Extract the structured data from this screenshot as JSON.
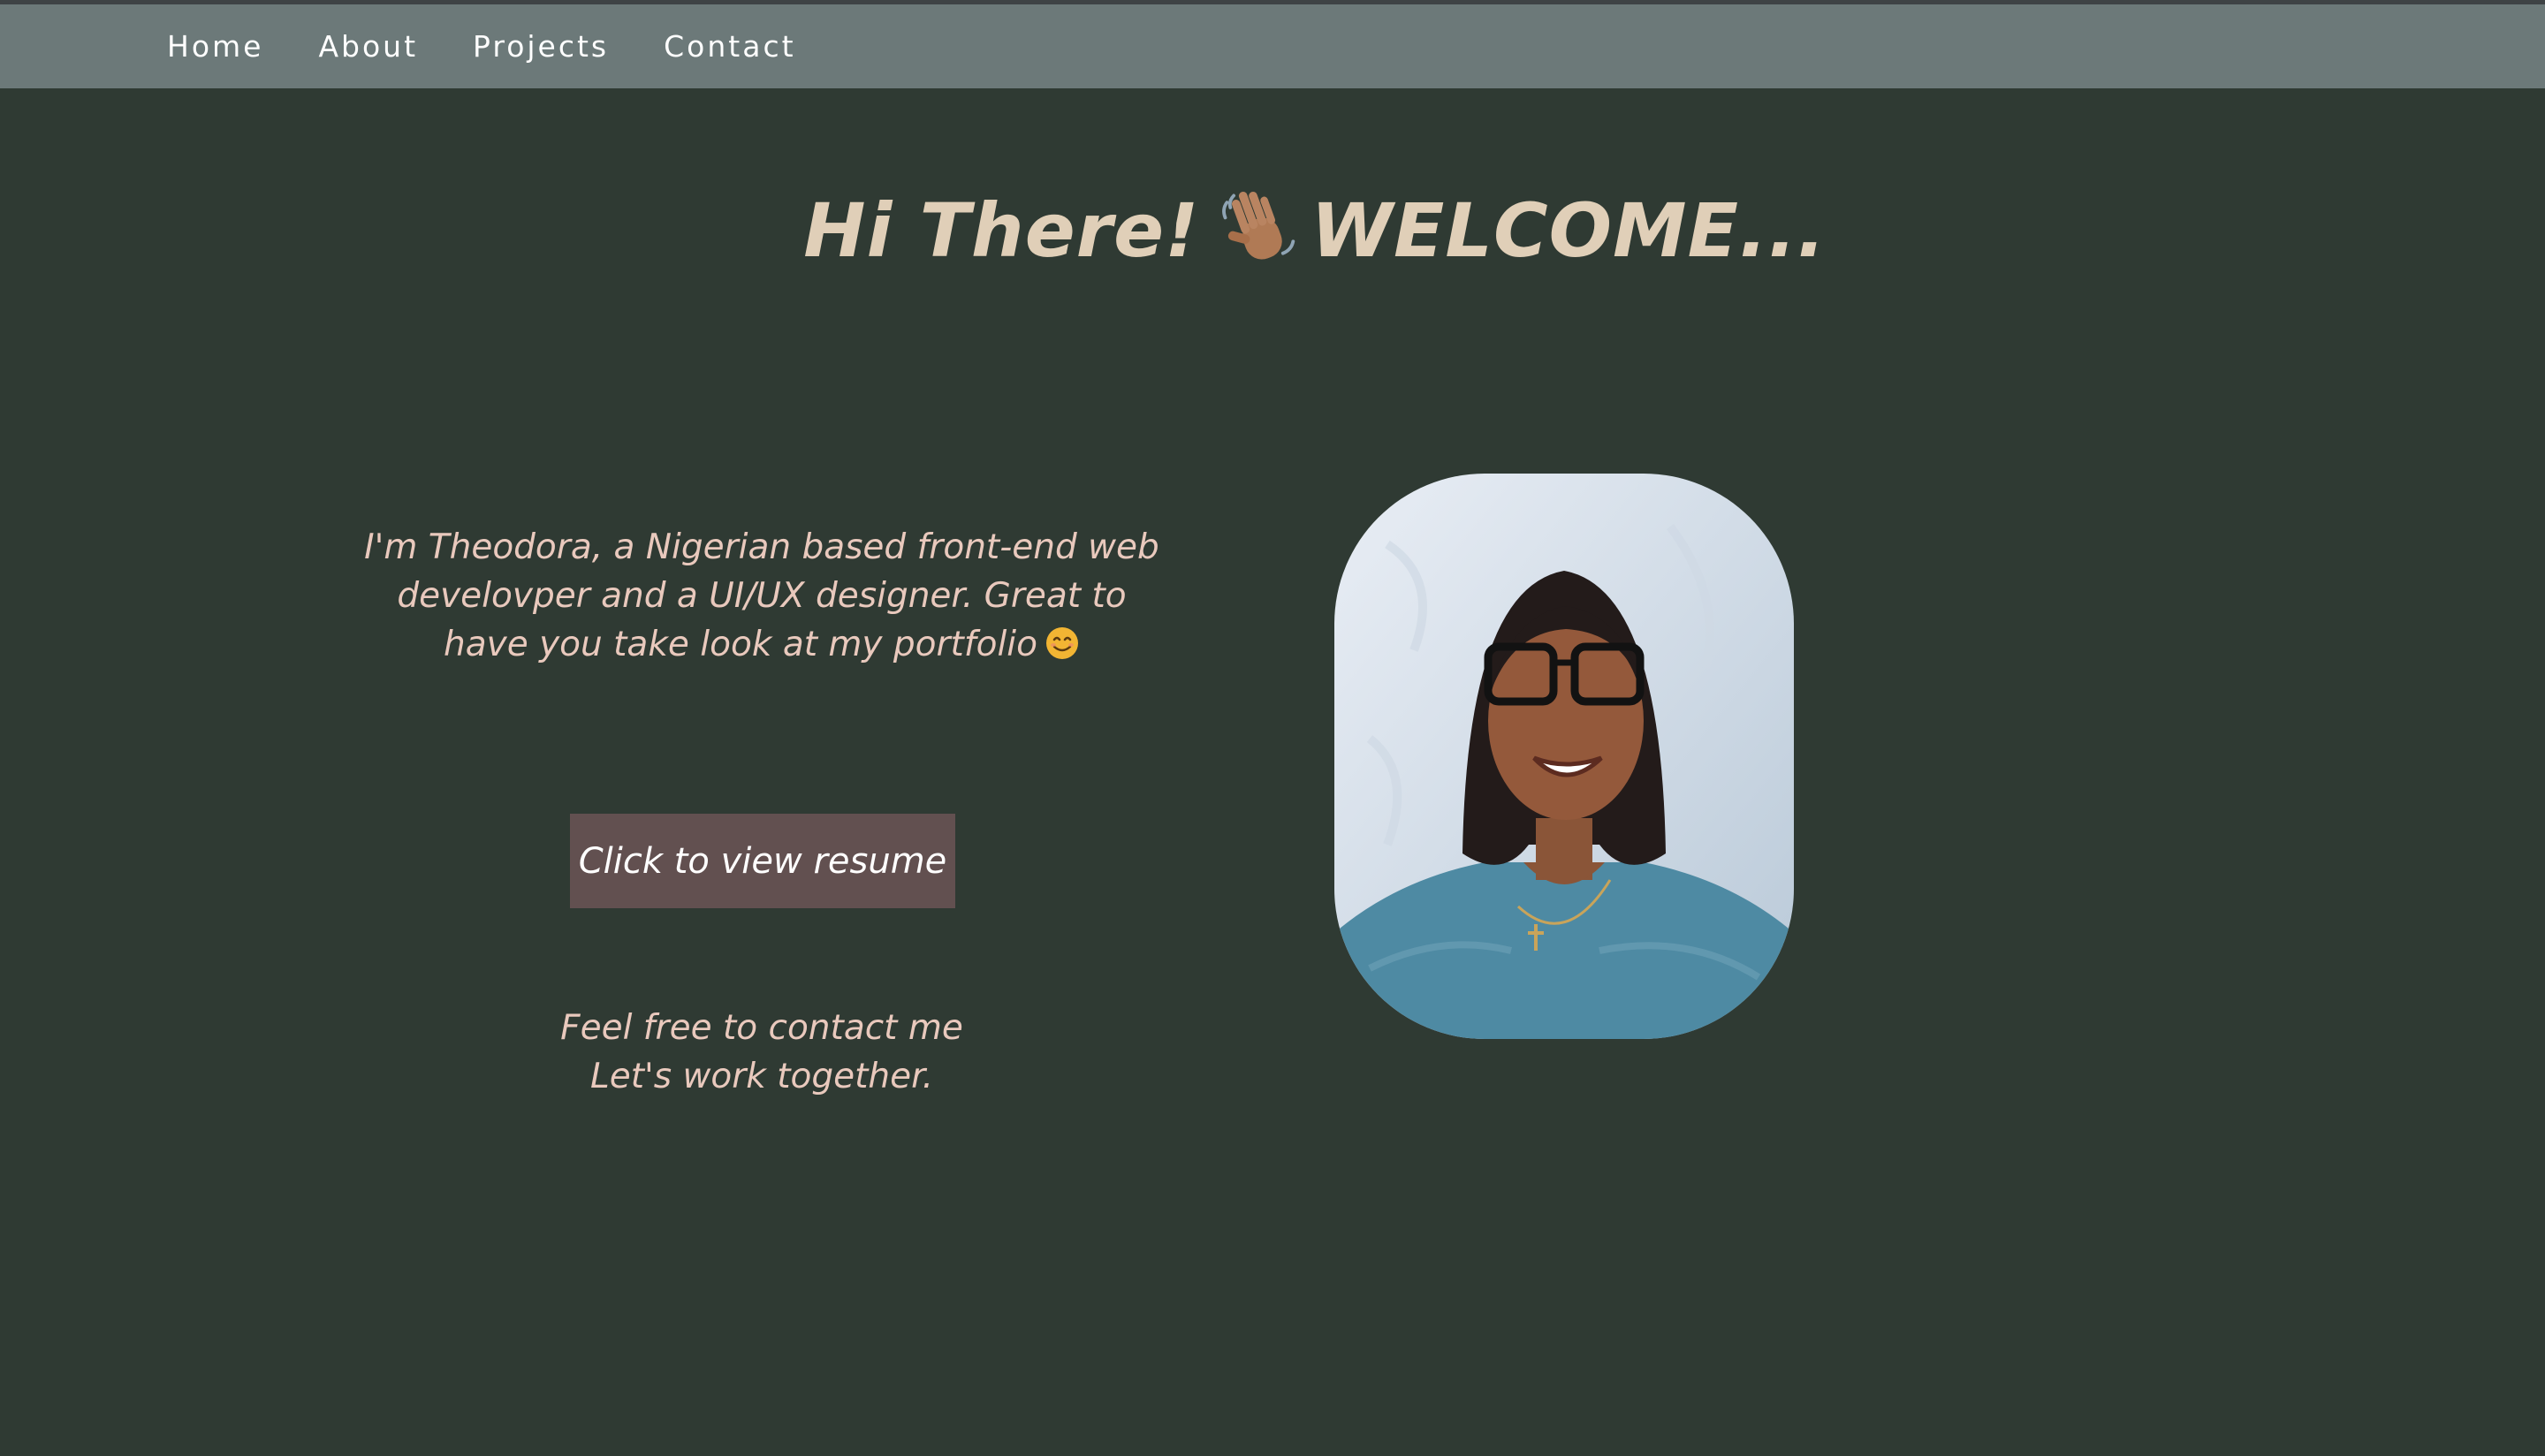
{
  "nav": {
    "items": [
      {
        "label": "Home"
      },
      {
        "label": "About"
      },
      {
        "label": "Projects"
      },
      {
        "label": "Contact"
      }
    ]
  },
  "hero": {
    "greeting": "Hi There!",
    "greeting_icon": "waving-hand-icon",
    "welcome": "WELCOME...",
    "intro_line1": "I'm Theodora, a Nigerian based front-end web",
    "intro_line2": "develovper and a UI/UX designer. Great to",
    "intro_line3": "have you take look at my portfolio",
    "intro_icon": "smiling-face-icon",
    "resume_button": "Click to view resume",
    "contact_line1": "Feel free to contact me",
    "contact_line2": "Let's work together."
  },
  "colors": {
    "background": "#2f3a33",
    "navbar": "#6c7979",
    "headline": "#e0cfb8",
    "body_text": "#e9c9bd",
    "button": "#625050"
  }
}
